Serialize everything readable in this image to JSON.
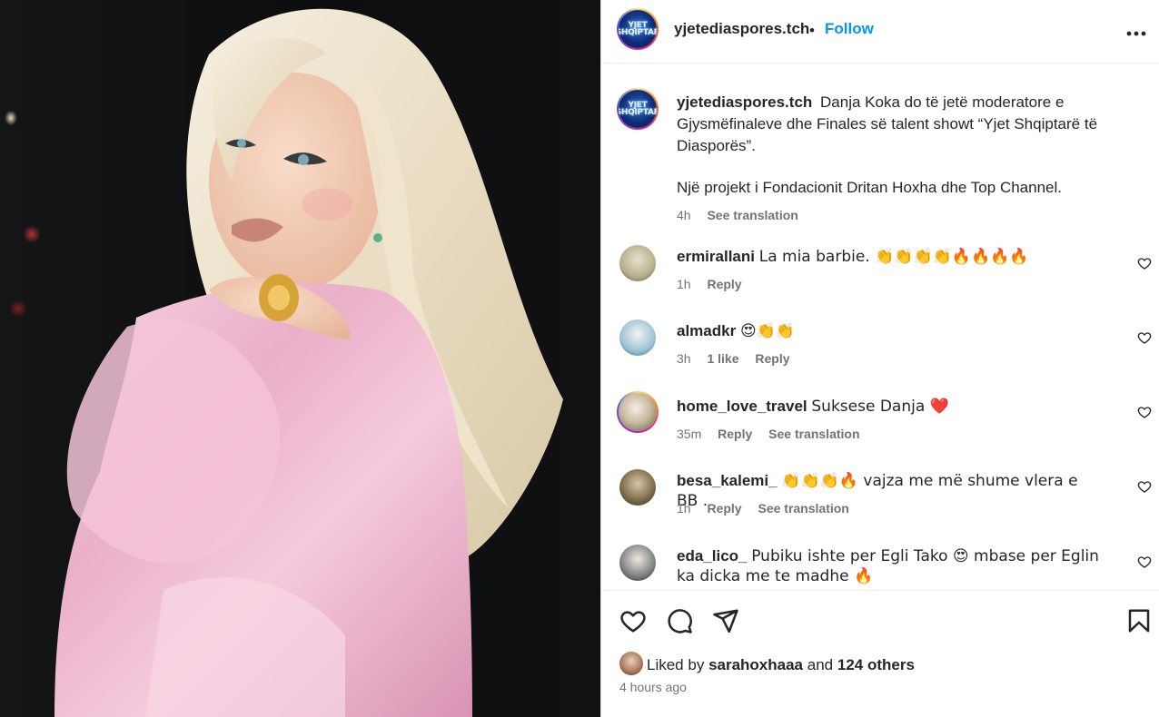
{
  "post": {
    "username": "yjetediaspores.tch",
    "separator": "•",
    "follow_label": "Follow",
    "more_label": "•••",
    "avatar_text": "YJET SHQIPTAR",
    "caption_line1": "Danja Koka do të jetë moderatore e Gjysmëfinaleve dhe Finales së talent showt “Yjet Shqiptarë të Diasporës”.",
    "caption_line2": "Një projekt i Fondacionit Dritan Hoxha dhe Top Channel.",
    "caption_age": "4h",
    "see_translation": "See translation"
  },
  "comments": [
    {
      "user": "ermirallani",
      "text": "La mia barbie. 👏👏👏👏🔥🔥🔥🔥",
      "age": "1h",
      "likes": "",
      "reply": "Reply",
      "translate": ""
    },
    {
      "user": "almadkr",
      "text": "😍👏👏",
      "age": "3h",
      "likes": "1 like",
      "reply": "Reply",
      "translate": ""
    },
    {
      "user": "home_love_travel",
      "text": "Suksese Danja ❤️",
      "age": "35m",
      "likes": "",
      "reply": "Reply",
      "translate": "See translation"
    },
    {
      "user": "besa_kalemi_",
      "text": "👏👏👏🔥 vajza me më shume vlera e BB .",
      "age": "1h",
      "likes": "",
      "reply": "Reply",
      "translate": "See translation"
    },
    {
      "user": "eda_lico_",
      "text": "Pubiku ishte per Egli Tako 😍 mbase per Eglin ka dicka me te madhe 🔥",
      "age": "",
      "likes": "",
      "reply": "",
      "translate": ""
    }
  ],
  "footer": {
    "liked_by_prefix": "Liked by",
    "liked_by_user": "sarahoxhaaa",
    "and_word": "and",
    "others": "124 others",
    "posted_time": "4 hours ago"
  },
  "icons": {
    "like": "heart-icon",
    "comment": "comment-icon",
    "share": "share-icon",
    "save": "bookmark-icon",
    "more": "more-icon"
  },
  "colors": {
    "follow": "#0095f6",
    "heart_red": "#ed4956",
    "muted": "#737373"
  }
}
